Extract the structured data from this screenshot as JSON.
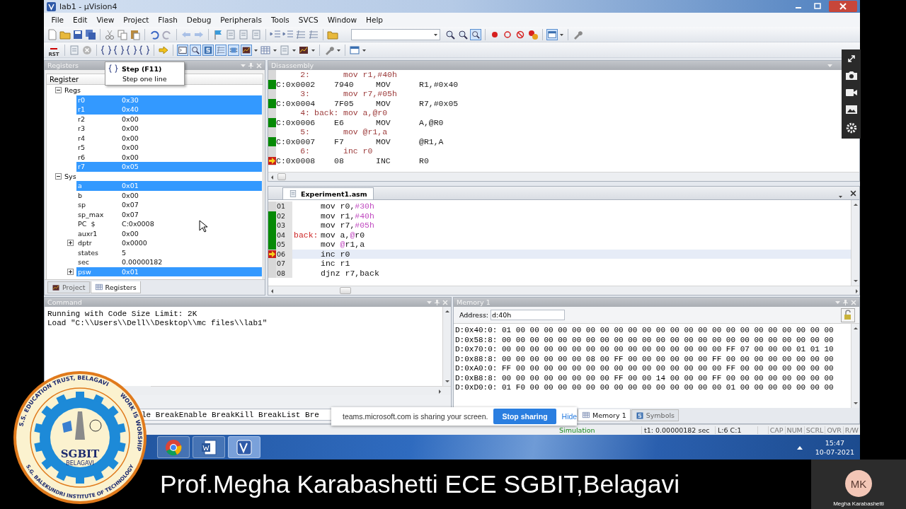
{
  "window": {
    "title": "lab1 - µVision4"
  },
  "menu": [
    "File",
    "Edit",
    "View",
    "Project",
    "Flash",
    "Debug",
    "Peripherals",
    "Tools",
    "SVCS",
    "Window",
    "Help"
  ],
  "toolbar": {
    "reset_label": "RST"
  },
  "tooltip": {
    "title": "Step (F11)",
    "text": "Step one line"
  },
  "registers_panel": {
    "title": "Registers",
    "column": "Register",
    "groups": [
      {
        "name": "Regs",
        "expanded": true,
        "items": [
          {
            "name": "r0",
            "value": "0x30",
            "selected": true
          },
          {
            "name": "r1",
            "value": "0x40",
            "selected": true
          },
          {
            "name": "r2",
            "value": "0x00",
            "selected": false
          },
          {
            "name": "r3",
            "value": "0x00",
            "selected": false
          },
          {
            "name": "r4",
            "value": "0x00",
            "selected": false
          },
          {
            "name": "r5",
            "value": "0x00",
            "selected": false
          },
          {
            "name": "r6",
            "value": "0x00",
            "selected": false
          },
          {
            "name": "r7",
            "value": "0x05",
            "selected": true
          }
        ]
      },
      {
        "name": "Sys",
        "expanded": true,
        "items": [
          {
            "name": "a",
            "value": "0x01",
            "selected": true
          },
          {
            "name": "b",
            "value": "0x00",
            "selected": false
          },
          {
            "name": "sp",
            "value": "0x07",
            "selected": false
          },
          {
            "name": "sp_max",
            "value": "0x07",
            "selected": false
          },
          {
            "name": "PC  $",
            "value": "C:0x0008",
            "selected": false
          },
          {
            "name": "auxr1",
            "value": "0x00",
            "selected": false
          },
          {
            "name": "dptr",
            "value": "0x0000",
            "selected": false,
            "expanded": false
          },
          {
            "name": "states",
            "value": "5",
            "selected": false
          },
          {
            "name": "sec",
            "value": "0.00000182",
            "selected": false
          },
          {
            "name": "psw",
            "value": "0x01",
            "selected": true,
            "expanded": false
          }
        ]
      }
    ],
    "tabs": [
      {
        "label": "Project",
        "selected": false
      },
      {
        "label": "Registers",
        "selected": true
      }
    ]
  },
  "disassembly": {
    "title": "Disassembly",
    "lines": [
      {
        "kind": "source",
        "line": "2:",
        "code": "mov r1,#40h"
      },
      {
        "kind": "asm",
        "address": "C:0x0002",
        "opcode": "7940",
        "mnemonic": "MOV",
        "operands": "R1,#0x40",
        "executed": true,
        "current": false
      },
      {
        "kind": "source",
        "line": "3:",
        "code": "mov r7,#05h"
      },
      {
        "kind": "asm",
        "address": "C:0x0004",
        "opcode": "7F05",
        "mnemonic": "MOV",
        "operands": "R7,#0x05",
        "executed": true,
        "current": false
      },
      {
        "kind": "source",
        "line": "4:",
        "label": "back:",
        "code": "mov a,@r0"
      },
      {
        "kind": "asm",
        "address": "C:0x0006",
        "opcode": "E6",
        "mnemonic": "MOV",
        "operands": "A,@R0",
        "executed": true,
        "current": false
      },
      {
        "kind": "source",
        "line": "5:",
        "code": "mov @r1,a"
      },
      {
        "kind": "asm",
        "address": "C:0x0007",
        "opcode": "F7",
        "mnemonic": "MOV",
        "operands": "@R1,A",
        "executed": true,
        "current": false
      },
      {
        "kind": "source",
        "line": "6:",
        "code": "inc r0"
      },
      {
        "kind": "asm",
        "address": "C:0x0008",
        "opcode": "08",
        "mnemonic": "INC",
        "operands": "R0",
        "executed": false,
        "current": true
      }
    ]
  },
  "editor": {
    "tab": "Experiment1.asm",
    "lines": [
      {
        "number": "01",
        "executed": false,
        "current": false,
        "segments": [
          {
            "text": "mov r0,",
            "kind": "code"
          },
          {
            "text": "#30h",
            "kind": "number"
          }
        ]
      },
      {
        "number": "02",
        "executed": true,
        "current": false,
        "segments": [
          {
            "text": "mov r1,",
            "kind": "code"
          },
          {
            "text": "#40h",
            "kind": "number"
          }
        ]
      },
      {
        "number": "03",
        "executed": true,
        "current": false,
        "segments": [
          {
            "text": "mov r7,",
            "kind": "code"
          },
          {
            "text": "#05h",
            "kind": "number"
          }
        ]
      },
      {
        "number": "04",
        "executed": true,
        "current": false,
        "label": "back:",
        "segments": [
          {
            "text": "mov a,",
            "kind": "code"
          },
          {
            "text": "@",
            "kind": "number"
          },
          {
            "text": "r0",
            "kind": "code"
          }
        ]
      },
      {
        "number": "05",
        "executed": true,
        "current": false,
        "segments": [
          {
            "text": "mov ",
            "kind": "code"
          },
          {
            "text": "@",
            "kind": "number"
          },
          {
            "text": "r1,a",
            "kind": "code"
          }
        ]
      },
      {
        "number": "06",
        "executed": false,
        "current": true,
        "segments": [
          {
            "text": "inc r0",
            "kind": "code"
          }
        ]
      },
      {
        "number": "07",
        "executed": false,
        "current": false,
        "segments": [
          {
            "text": "inc r1",
            "kind": "code"
          }
        ]
      },
      {
        "number": "08",
        "executed": false,
        "current": false,
        "segments": [
          {
            "text": "djnz r7,back",
            "kind": "code"
          }
        ]
      }
    ]
  },
  "command": {
    "title": "Command",
    "lines": [
      "Running with Code Size Limit: 2K",
      "Load \"C:\\\\Users\\\\Dell\\\\Desktop\\\\mc files\\\\lab1\""
    ],
    "input": "le BreakEnable BreakKill BreakList Bre"
  },
  "memory": {
    "title": "Memory 1",
    "address_label": "Address:",
    "address": "d:40h",
    "rows": [
      "D:0x40:0: 01 00 00 00 00 00 00 00 00 00 00 00 00 00 00 00 00 00 00 00 00 00 00 00",
      "D:0x58:8: 00 00 00 00 00 00 00 00 00 00 00 00 00 00 00 00 00 00 00 00 00 00 00 00",
      "D:0x70:0: 00 00 00 00 00 00 00 00 00 00 00 00 00 00 00 00 FF 07 00 00 00 01 01 10",
      "D:0x88:8: 00 00 00 00 00 00 08 00 FF 00 00 00 00 00 00 FF 00 00 00 00 00 00 00 00",
      "D:0xA0:0: FF 00 00 00 00 00 00 00 00 00 00 00 00 00 00 00 FF 00 00 00 00 00 00 00",
      "D:0xB8:8: 00 00 00 00 00 00 00 00 FF 00 00 14 00 00 00 FF 00 00 00 00 00 00 00 00",
      "D:0xD0:0: 01 F0 00 00 00 00 00 00 00 00 00 00 00 00 00 00 01 00 00 00 00 00 00 00"
    ],
    "tabs": [
      {
        "label": "Memory 1",
        "selected": true
      },
      {
        "label": "Symbols",
        "selected": false
      }
    ]
  },
  "status_bar": {
    "mode": "Simulation",
    "time": "t1: 0.00000182 sec",
    "position": "L:6 C:1",
    "indicators": [
      "CAP",
      "NUM",
      "SCRL",
      "OVR",
      "R/W"
    ]
  },
  "taskbar": {
    "time": "15:47",
    "date": "10-07-2021"
  },
  "share_notice": {
    "text": "teams.microsoft.com is sharing your screen.",
    "stop": "Stop sharing",
    "hide": "Hide"
  },
  "logo": {
    "top": "S.S. EDUCATION TRUST, BELAGAVI",
    "right": "WORK IS WORSHIP",
    "bottom": "S.G. BALEKUNDRI INSTITUTE OF TECHNOLOGY",
    "name": "SGBIT",
    "city": "BELAGAVI"
  },
  "caption": "Prof.Megha Karabashetti ECE SGBIT,Belagavi",
  "participant": {
    "initials": "MK",
    "name": "Megha Karabashetti"
  }
}
